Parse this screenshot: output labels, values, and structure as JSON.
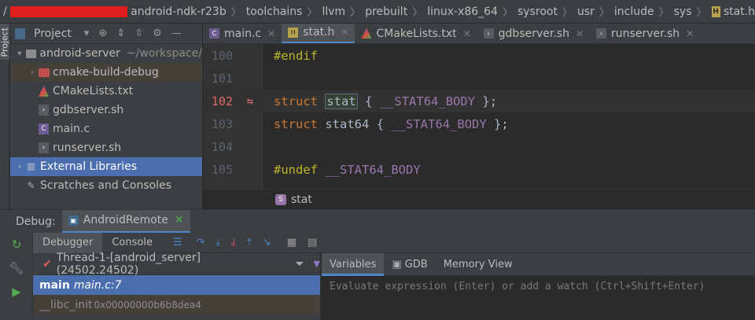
{
  "breadcrumb": {
    "items": [
      "android-ndk-r23b",
      "toolchains",
      "llvm",
      "prebuilt",
      "linux-x86_64",
      "sysroot",
      "usr",
      "include",
      "sys",
      "stat.h"
    ]
  },
  "stripe": {
    "project_label": "Project"
  },
  "project": {
    "title": "Project",
    "tree": [
      {
        "label": "android-server",
        "hint": "~/workspace/",
        "type": "folder-root"
      },
      {
        "label": "cmake-build-debug",
        "type": "folder-build"
      },
      {
        "label": "CMakeLists.txt",
        "type": "cmake"
      },
      {
        "label": "gdbserver.sh",
        "type": "sh"
      },
      {
        "label": "main.c",
        "type": "c"
      },
      {
        "label": "runserver.sh",
        "type": "sh"
      },
      {
        "label": "External Libraries",
        "type": "lib"
      },
      {
        "label": "Scratches and Consoles",
        "type": "scratch"
      }
    ]
  },
  "editor_tabs": [
    {
      "label": "main.c",
      "icon": "c-file-icon"
    },
    {
      "label": "stat.h",
      "icon": "h-file-icon",
      "active": true
    },
    {
      "label": "CMakeLists.txt",
      "icon": "cmake-icon"
    },
    {
      "label": "gdbserver.sh",
      "icon": "shell-icon"
    },
    {
      "label": "runserver.sh",
      "icon": "shell-icon"
    }
  ],
  "editor": {
    "lines": [
      {
        "num": "100",
        "code": "#endif"
      },
      {
        "num": "101",
        "code": ""
      },
      {
        "num": "102",
        "code": "struct stat { __STAT64_BODY };"
      },
      {
        "num": "103",
        "code": "struct stat64 { __STAT64_BODY };"
      },
      {
        "num": "104",
        "code": ""
      },
      {
        "num": "105",
        "code": "#undef __STAT64_BODY"
      }
    ],
    "tokens": {
      "endif": "#endif",
      "undef": "#undef",
      "struct": "struct",
      "stat": "stat",
      "stat64": "stat64",
      "brace_open": "{",
      "brace_close": "};",
      "macro": "__STAT64_BODY"
    },
    "symbol_crumb": "stat",
    "symbol_badge": "S"
  },
  "debug": {
    "title": "Debug:",
    "config": "AndroidRemote",
    "tabs": [
      "Debugger",
      "Console"
    ],
    "thread": "Thread-1-[android_server] (24502.24502)",
    "frames": [
      {
        "fn": "main",
        "loc": "main.c:7"
      },
      {
        "fn": "__libc_init",
        "loc": "0x00000000b6b8dea4"
      }
    ],
    "var_tabs": [
      "Variables",
      "GDB",
      "Memory View"
    ],
    "watch_placeholder": "Evaluate expression (Enter) or add a watch (Ctrl+Shift+Enter)"
  },
  "colors": {
    "accent": "#4a88c7",
    "selection": "#4b6eaf",
    "keyword": "#cc7832",
    "macro": "#9876aa",
    "preprocessor": "#bbb529"
  }
}
